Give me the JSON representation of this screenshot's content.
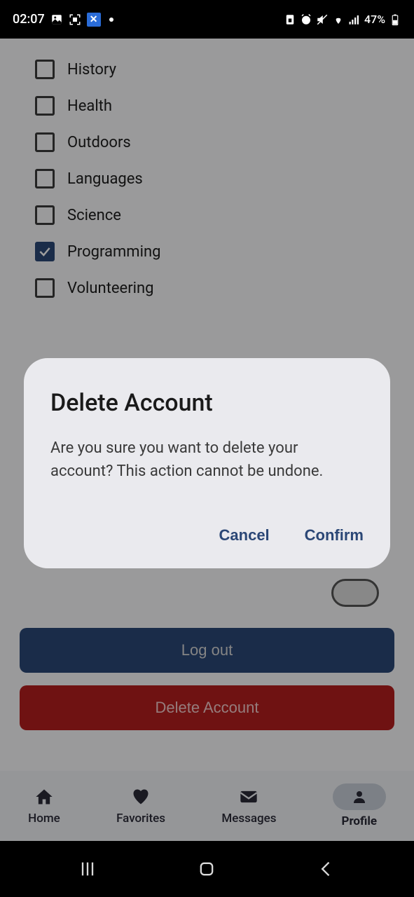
{
  "status": {
    "time": "02:07",
    "battery": "47%"
  },
  "interests": [
    {
      "label": "History",
      "checked": false
    },
    {
      "label": "Health",
      "checked": false
    },
    {
      "label": "Outdoors",
      "checked": false
    },
    {
      "label": "Languages",
      "checked": false
    },
    {
      "label": "Science",
      "checked": false
    },
    {
      "label": "Programming",
      "checked": true
    },
    {
      "label": "Volunteering",
      "checked": false
    }
  ],
  "buttons": {
    "logout": "Log out",
    "delete_account": "Delete Account"
  },
  "nav": {
    "home": "Home",
    "favorites": "Favorites",
    "messages": "Messages",
    "profile": "Profile"
  },
  "dialog": {
    "title": "Delete Account",
    "body": "Are you sure you want to delete your account? This action cannot be undone.",
    "cancel": "Cancel",
    "confirm": "Confirm"
  }
}
